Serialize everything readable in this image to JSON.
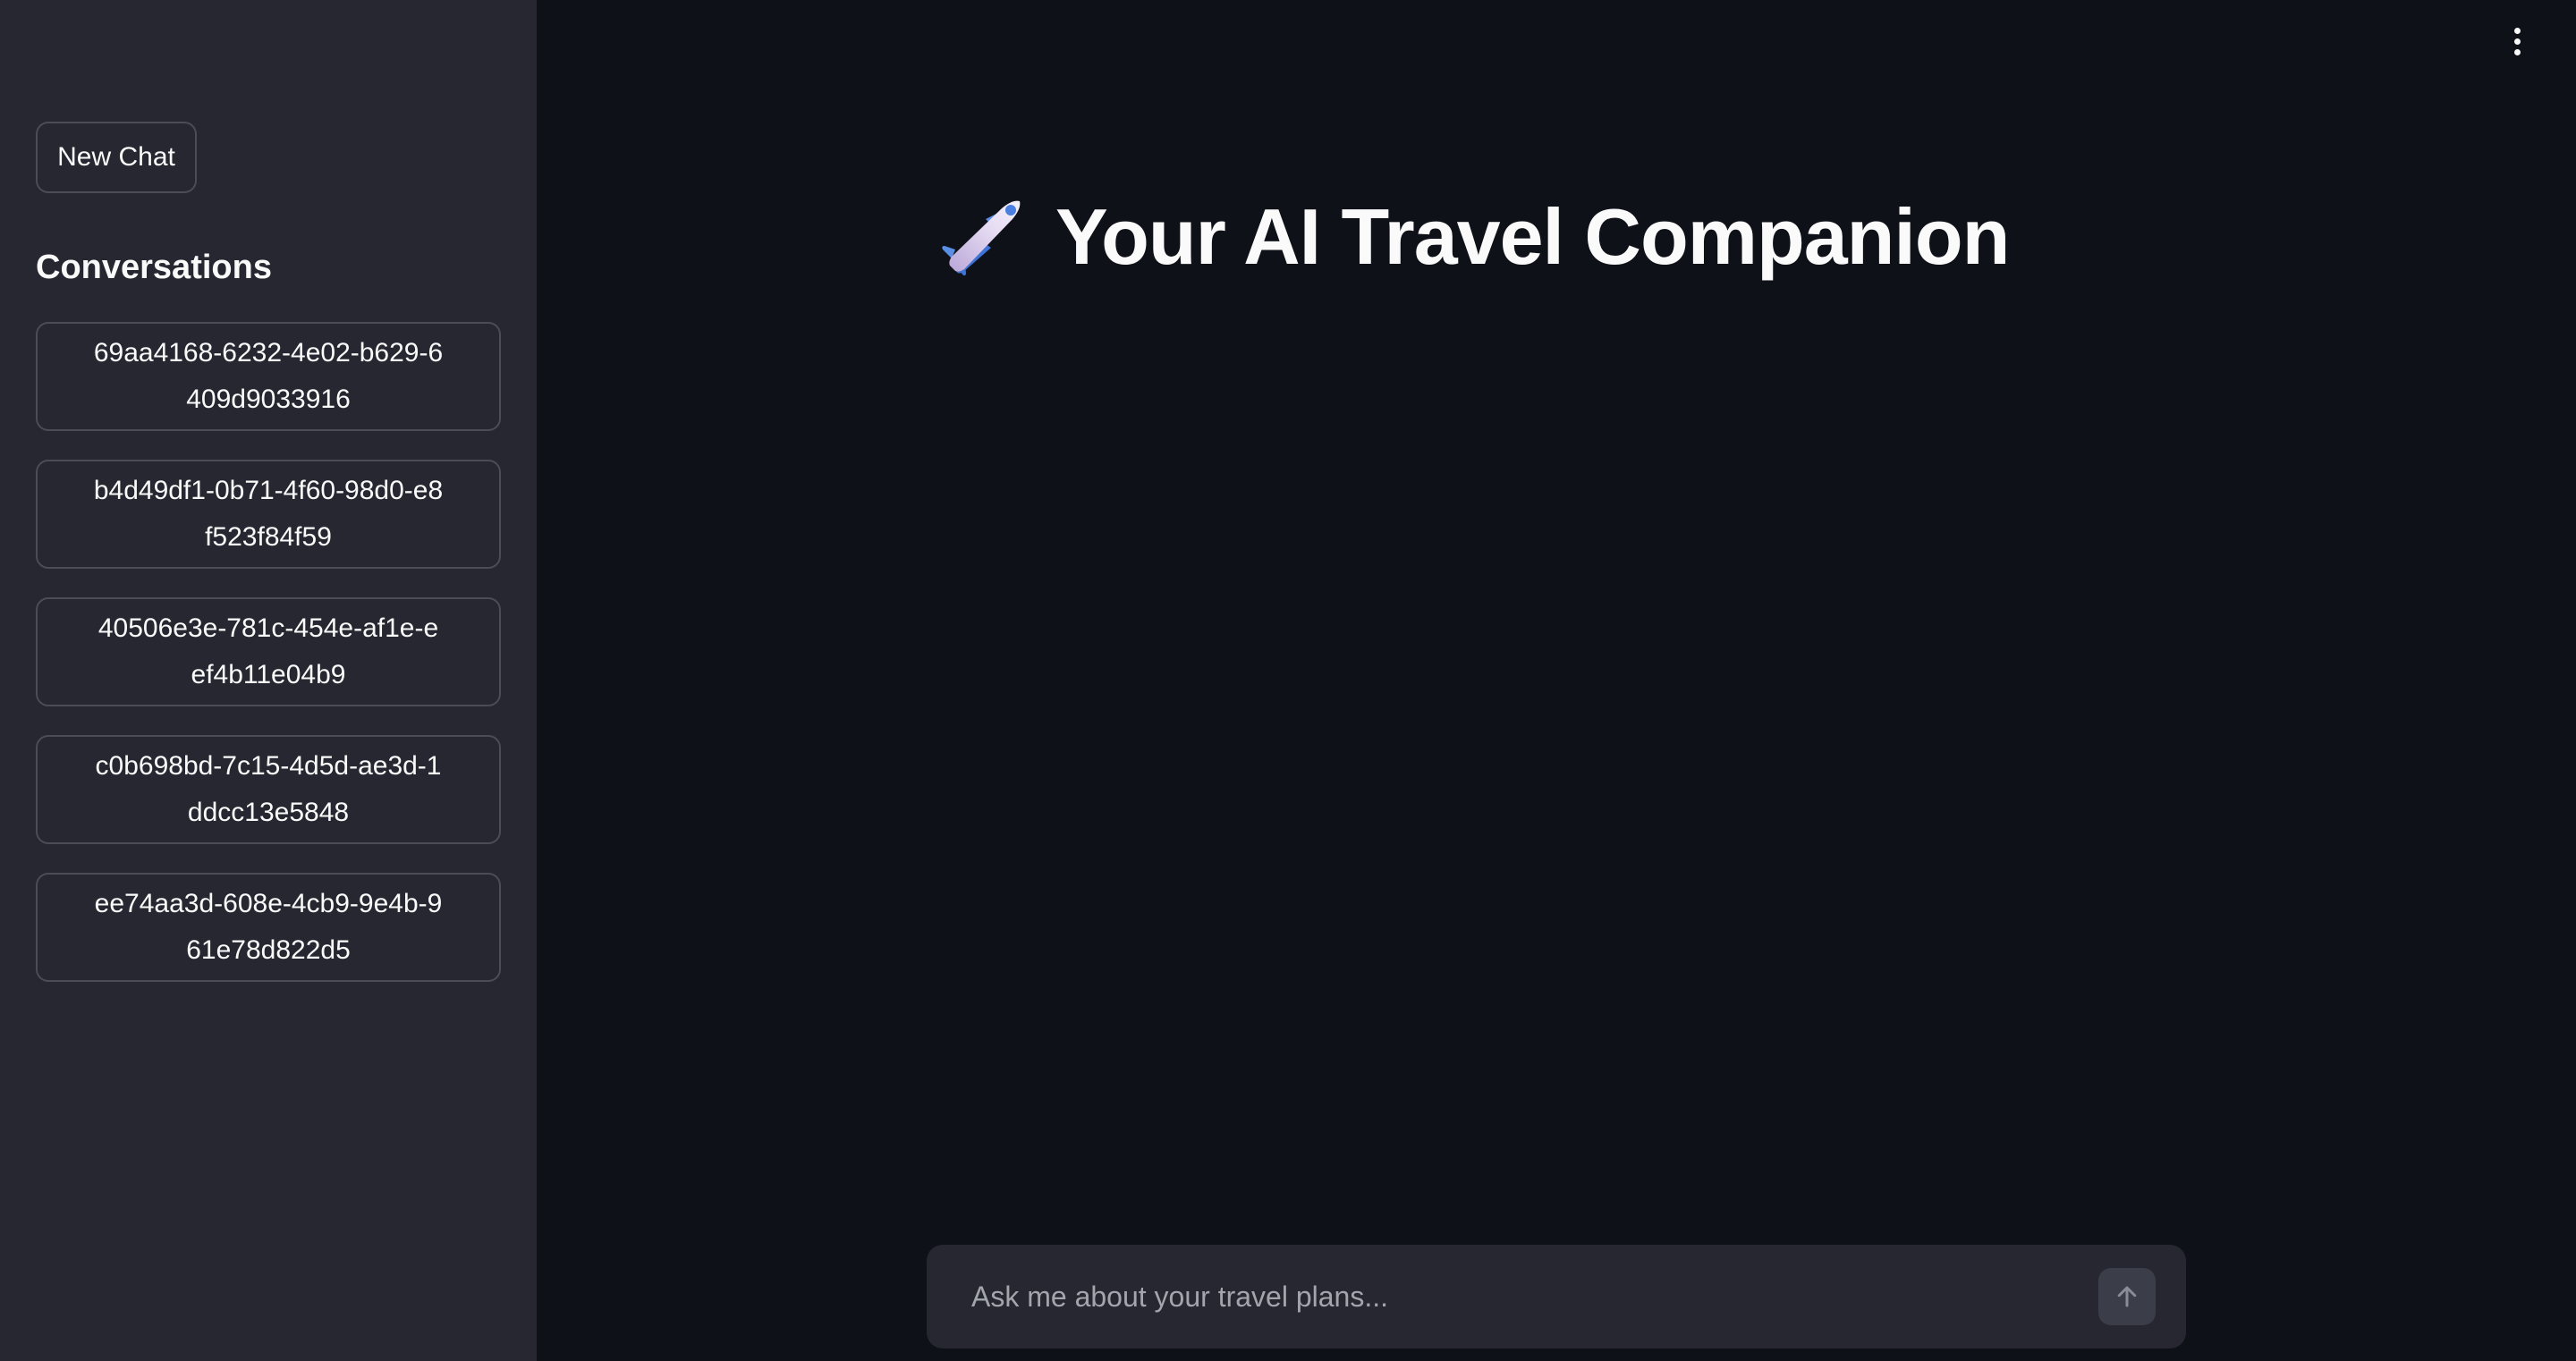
{
  "sidebar": {
    "new_chat_label": "New Chat",
    "heading": "Conversations",
    "conversations": [
      {
        "label": "69aa4168-6232-4e02-b629-6409d9033916"
      },
      {
        "label": "b4d49df1-0b71-4f60-98d0-e8f523f84f59"
      },
      {
        "label": "40506e3e-781c-454e-af1e-eef4b11e04b9"
      },
      {
        "label": "c0b698bd-7c15-4d5d-ae3d-1ddcc13e5848"
      },
      {
        "label": "ee74aa3d-608e-4cb9-9e4b-961e78d822d5"
      }
    ]
  },
  "main": {
    "title_icon": "airplane-icon",
    "title": "Your AI Travel Companion",
    "menu_icon": "kebab-menu-icon"
  },
  "chat_input": {
    "placeholder": "Ask me about your travel plans...",
    "value": "",
    "send_icon": "arrow-up-icon"
  },
  "colors": {
    "background": "#0e1117",
    "sidebar": "#262730",
    "text": "#fafafa",
    "border": "#4a4c57",
    "placeholder": "#a3a5ad"
  }
}
